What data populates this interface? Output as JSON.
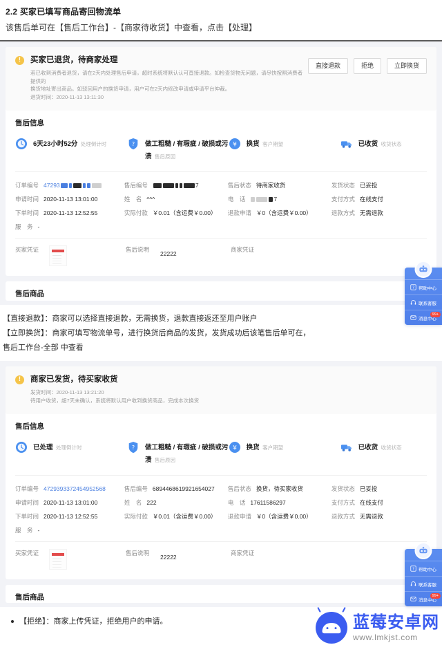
{
  "doc": {
    "title": "2.2 买家已填写商品寄回物流单",
    "subtitle": "该售后单可在【售后工作台】-【商家待收货】中查看，点击【处理】"
  },
  "card1": {
    "alert": {
      "title": "买家已退货，待商家处理",
      "desc_line1": "若已收到消费者退货，请在2天内处理售后申请，超时系统将默认认可直接退款。如检查货物无问题，请尽快按照消费者提供的",
      "desc_line2": "换货地址寄出商品。如驳回用户的换货申请，用户可在2天内修改申请或申请平台仲裁。",
      "desc_line3": "退货时间：2020-11-13 13:11:30",
      "actions": [
        "直接退款",
        "拒绝",
        "立即换货"
      ]
    },
    "section_title": "售后信息",
    "strip": [
      {
        "icon": "clock-icon",
        "main": "6天23小时52分",
        "sub": "处理倒计时"
      },
      {
        "icon": "shield-question-icon",
        "main": "做工粗糙 / 有瑕疵 / 破损或污渍",
        "sub": "售后原因"
      },
      {
        "icon": "money-icon",
        "main": "换货",
        "sub": "客户期望"
      },
      {
        "icon": "truck-icon",
        "main": "已收货",
        "sub": "收货状态"
      }
    ],
    "details": {
      "order_no_label": "订单编号",
      "order_no_value": "47293",
      "order_no_redacted": true,
      "aftersale_no_label": "售后编号",
      "aftersale_no_value": "7",
      "aftersale_no_redacted": true,
      "aftersale_status_label": "售后状态",
      "aftersale_status_value": "待商家收货",
      "ship_status_label": "发货状态",
      "ship_status_value": "已妥投",
      "apply_time_label": "申请时间",
      "apply_time_value": "2020-11-13 13:01:00",
      "name_label": "姓　名",
      "name_value": "^^^",
      "phone_label": "电　话",
      "phone_value": "7",
      "phone_redacted": true,
      "pay_method_label": "支付方式",
      "pay_method_value": "在线支付",
      "order_time_label": "下单时间",
      "order_time_value": "2020-11-13 12:52:55",
      "paid_label": "实际付款",
      "paid_value": "￥0.01（含运费￥0.00）",
      "refund_apply_label": "退款申请",
      "refund_apply_value": "￥0（含运费￥0.00）",
      "refund_method_label": "退款方式",
      "refund_method_value": "无需退款",
      "service_label": "服　务",
      "service_value": "-"
    },
    "proof": {
      "buyer_label": "买家凭证",
      "note_label": "售后说明",
      "note_value": "22222",
      "merchant_label": "商家凭证"
    },
    "goods_title": "售后商品"
  },
  "explain": {
    "line1": "【直接退款】：商家可以选择直接退款，无需换货，退款直接返还至用户账户",
    "line2": "【立即换货】：商家可填写物流单号，进行换货后商品的发货，发货成功后该笔售后单可在，",
    "line3": "售后工作台-全部 中查看"
  },
  "card2": {
    "alert": {
      "title": "商家已发货，待买家收货",
      "desc_line1": "发货时间：2020-11-13 13:21:20",
      "desc_line2": "待用户收货，超7天未确认，系统将默认用户收到换货商品，完成本次换货"
    },
    "section_title": "售后信息",
    "strip": [
      {
        "icon": "clock-icon",
        "main": "已处理",
        "sub": "处理倒计时"
      },
      {
        "icon": "shield-question-icon",
        "main": "做工粗糙 / 有瑕疵 / 破损或污渍",
        "sub": "售后原因"
      },
      {
        "icon": "money-icon",
        "main": "换货",
        "sub": "客户期望"
      },
      {
        "icon": "truck-icon",
        "main": "已收货",
        "sub": "收货状态"
      }
    ],
    "details": {
      "order_no_label": "订单编号",
      "order_no_value": "4729393372454952568",
      "aftersale_no_label": "售后编号",
      "aftersale_no_value": "6894468619921654027",
      "aftersale_status_label": "售后状态",
      "aftersale_status_value": "换货，待买家收货",
      "ship_status_label": "发货状态",
      "ship_status_value": "已妥投",
      "apply_time_label": "申请时间",
      "apply_time_value": "2020-11-13 13:01:00",
      "name_label": "姓　名",
      "name_value": "222",
      "phone_label": "电　话",
      "phone_value": "17611586297",
      "pay_method_label": "支付方式",
      "pay_method_value": "在线支付",
      "order_time_label": "下单时间",
      "order_time_value": "2020-11-13 12:52:55",
      "paid_label": "实际付款",
      "paid_value": "￥0.01（含运费￥0.00）",
      "refund_apply_label": "退款申请",
      "refund_apply_value": "￥0（含运费￥0.00）",
      "refund_method_label": "退款方式",
      "refund_method_value": "无需退款",
      "service_label": "服　务",
      "service_value": "-"
    },
    "proof": {
      "buyer_label": "买家凭证",
      "note_label": "售后说明",
      "note_value": "22222",
      "merchant_label": "商家凭证"
    },
    "goods_title": "售后商品"
  },
  "bullet": "【拒绝】：商家上传凭证，拒绝用户的申请。",
  "helper": {
    "items": [
      {
        "icon": "help-book-icon",
        "label": "帮助中心",
        "badge": ""
      },
      {
        "icon": "headset-icon",
        "label": "联系客服",
        "badge": ""
      },
      {
        "icon": "message-icon",
        "label": "消息中心",
        "badge": "99+"
      }
    ]
  },
  "watermark": {
    "name": "蓝莓安卓网",
    "url": "www.lmkjst.com"
  },
  "colors": {
    "accent": "#4a7fe0",
    "warning": "#f5c449",
    "helper_bg": "#5b8df0",
    "badge": "#f5483b",
    "page_bg": "#f2f3f7"
  }
}
